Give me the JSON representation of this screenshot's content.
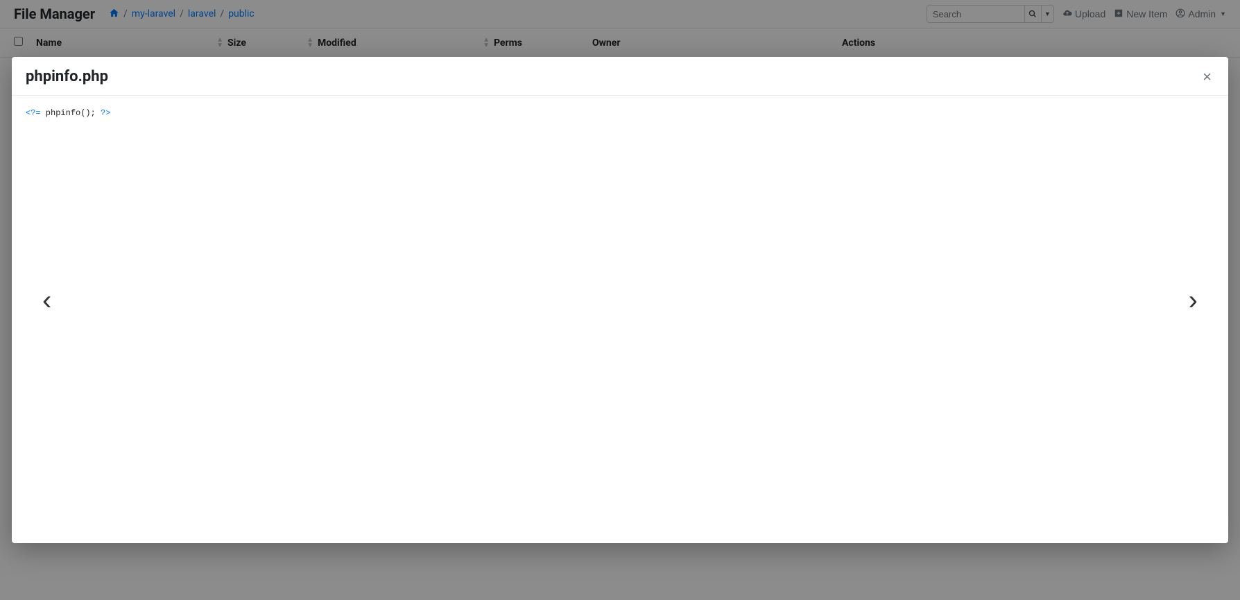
{
  "header": {
    "app_title": "File Manager",
    "breadcrumb": [
      "my-laravel",
      "laravel",
      "public"
    ],
    "search_placeholder": "Search",
    "upload_label": "Upload",
    "new_item_label": "New Item",
    "admin_label": "Admin"
  },
  "table": {
    "columns": {
      "name": "Name",
      "size": "Size",
      "modified": "Modified",
      "perms": "Perms",
      "owner": "Owner",
      "actions": "Actions"
    }
  },
  "modal": {
    "title": "phpinfo.php",
    "file_content": "<?= phpinfo(); ?>",
    "code_open": "<?=",
    "code_body": " phpinfo(); ",
    "code_close": "?>"
  }
}
